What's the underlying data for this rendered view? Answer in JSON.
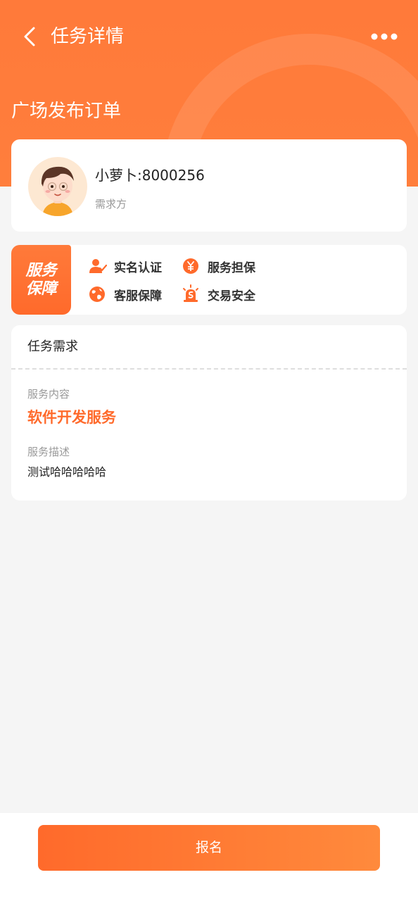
{
  "header": {
    "title": "任务详情",
    "subtitle": "广场发布订单",
    "back_icon": "chevron-left-icon",
    "more_icon": "more-dots-icon"
  },
  "user": {
    "name": "小萝卜:8000256",
    "role": "需求方",
    "avatar_icon": "avatar-boy-illustration"
  },
  "service_guarantee": {
    "badge": "服务保障",
    "items": [
      {
        "label": "实名认证",
        "icon": "user-check-icon"
      },
      {
        "label": "服务担保",
        "icon": "yuan-coin-icon"
      },
      {
        "label": "客服保障",
        "icon": "globe-icon"
      },
      {
        "label": "交易安全",
        "icon": "alarm-siren-icon"
      }
    ]
  },
  "task": {
    "header": "任务需求",
    "content_label": "服务内容",
    "content_value": "软件开发服务",
    "desc_label": "服务描述",
    "desc_value": "测试哈哈哈哈哈"
  },
  "footer": {
    "button_label": "报名"
  },
  "colors": {
    "accent": "#ff7a3a",
    "accent_text": "#ff6a2b",
    "background": "#f5f5f5"
  }
}
